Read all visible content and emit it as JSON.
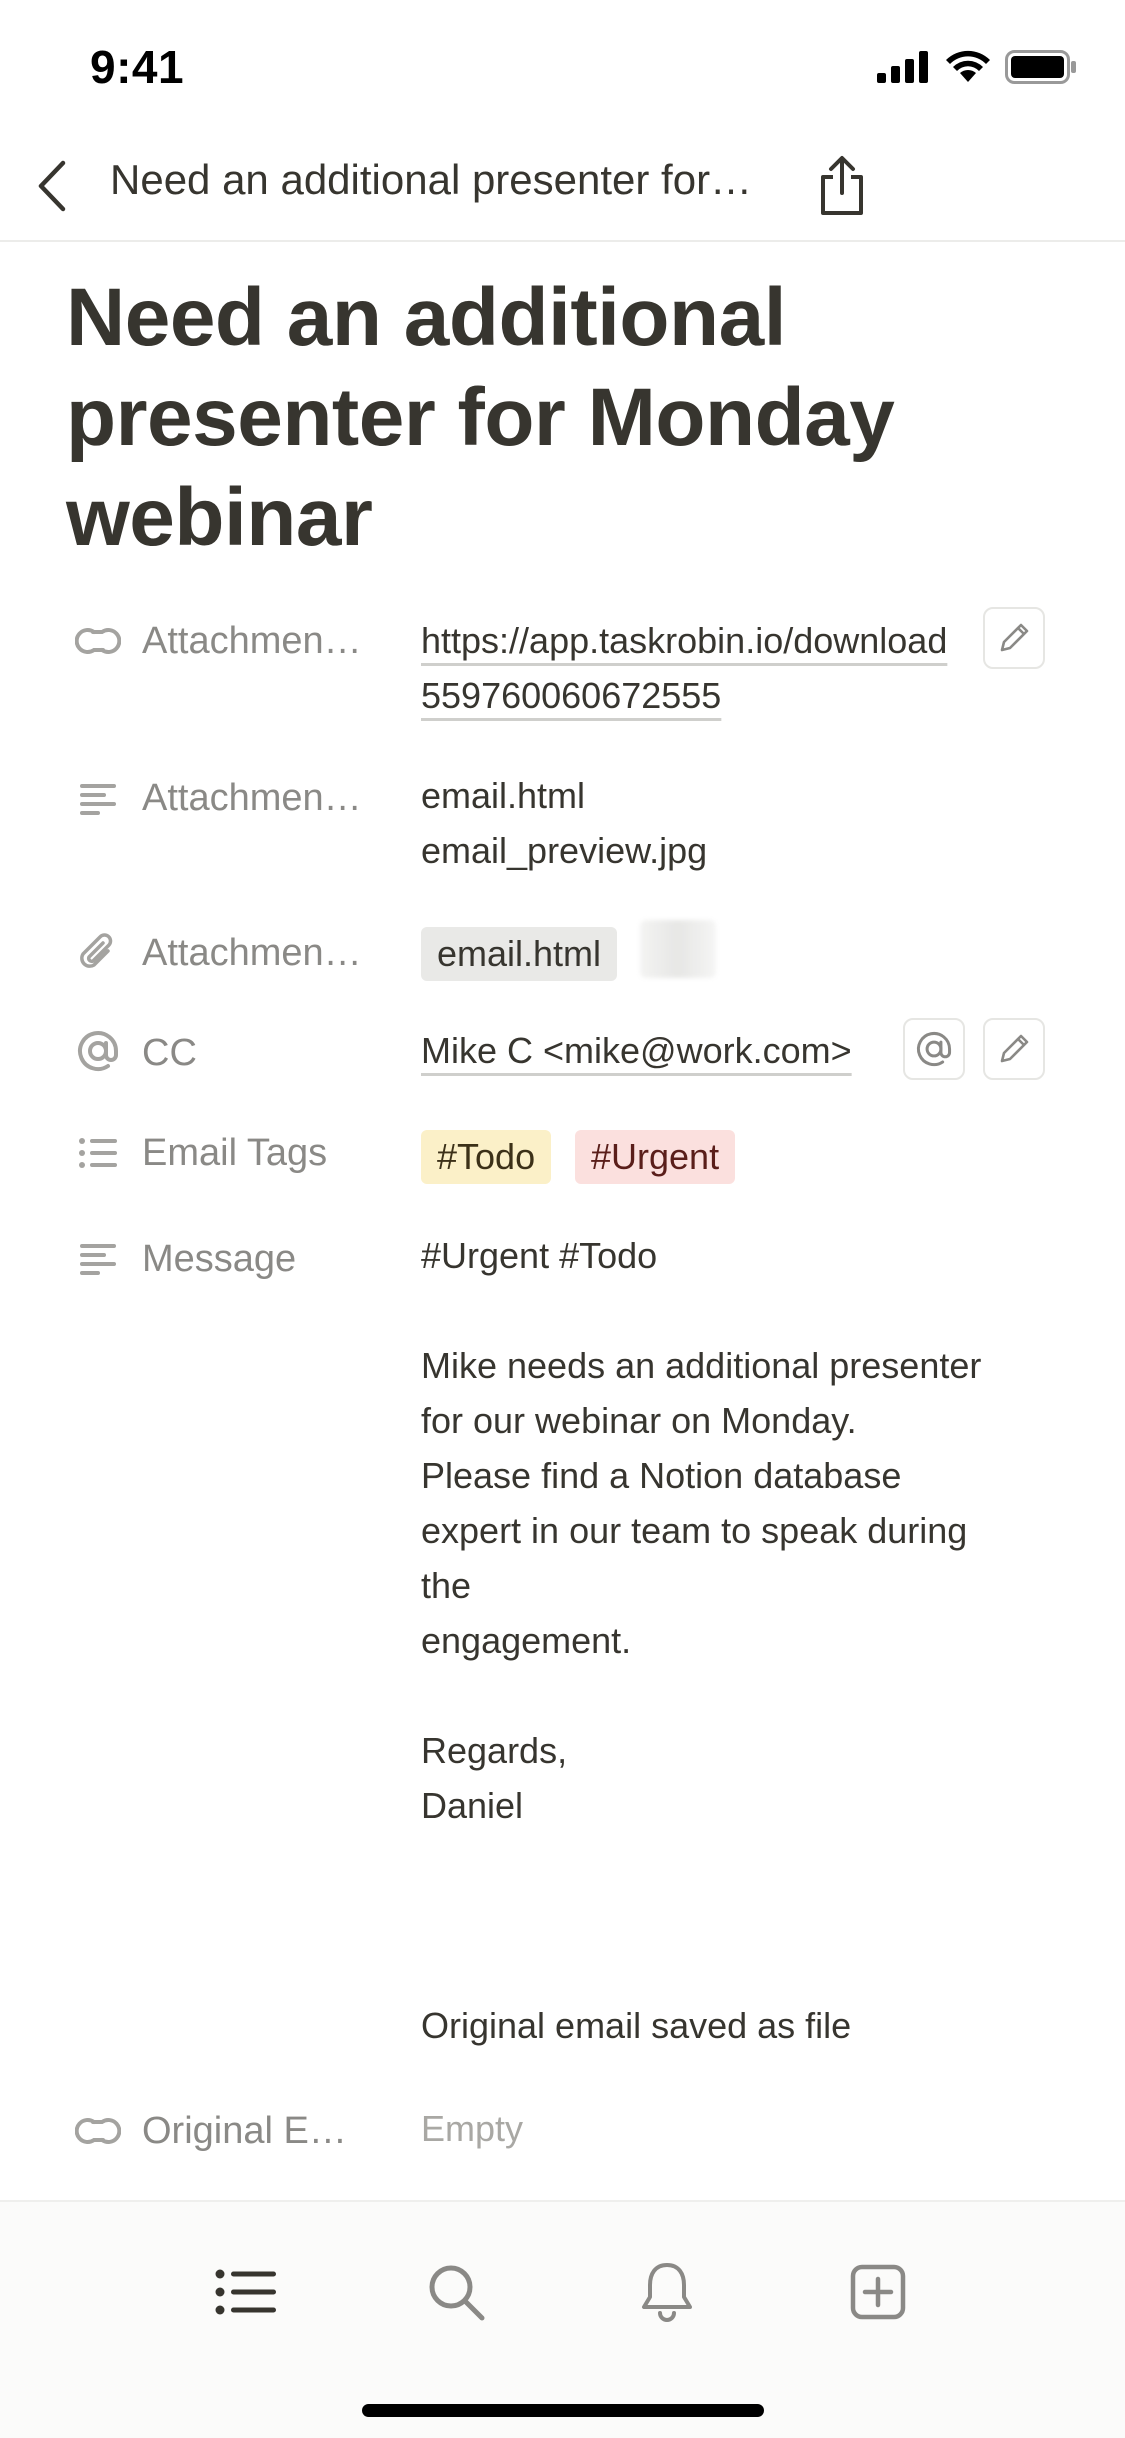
{
  "status_bar": {
    "time": "9:41"
  },
  "nav": {
    "title": "Need an additional presenter for…"
  },
  "page": {
    "title_lines": [
      "Need an additional",
      "presenter for Monday",
      "webinar"
    ]
  },
  "properties": {
    "attachment_url": {
      "label": "Attachmen…",
      "icon": "relation-icon",
      "value_lines": [
        "https://app.taskrobin.io/download",
        "559760060672555"
      ]
    },
    "attachment_names": {
      "label": "Attachmen…",
      "icon": "text-icon",
      "value_lines": [
        "email.html",
        "email_preview.jpg"
      ]
    },
    "attachment_files": {
      "label": "Attachmen…",
      "icon": "paperclip-icon",
      "file": "email.html"
    },
    "cc": {
      "label": "CC",
      "icon": "at-icon",
      "value": "Mike C <mike@work.com>"
    },
    "email_tags": {
      "label": "Email Tags",
      "icon": "list-icon",
      "tags": [
        {
          "label": "#Todo",
          "bg": "#fbf0c8"
        },
        {
          "label": "#Urgent",
          "bg": "#fbe0de"
        }
      ]
    },
    "message": {
      "label": "Message",
      "icon": "text-icon",
      "lines": [
        "#Urgent #Todo",
        "",
        "Mike needs an additional presenter",
        "for our webinar on Monday.",
        "Please find a Notion database",
        "expert in our team to speak during",
        "the",
        "engagement.",
        "",
        "Regards,",
        "Daniel",
        "",
        "",
        "",
        "Original email saved as file"
      ]
    },
    "original_email": {
      "label": "Original E…",
      "icon": "relation-icon",
      "value": "Empty"
    }
  },
  "tabbar": {
    "items": [
      "list-icon",
      "search-icon",
      "bell-icon",
      "add-page-icon"
    ]
  },
  "colors": {
    "text": "#37352f",
    "muted": "#8a8986",
    "tag_todo": "#fbf0c8",
    "tag_urgent": "#fbe0de"
  }
}
